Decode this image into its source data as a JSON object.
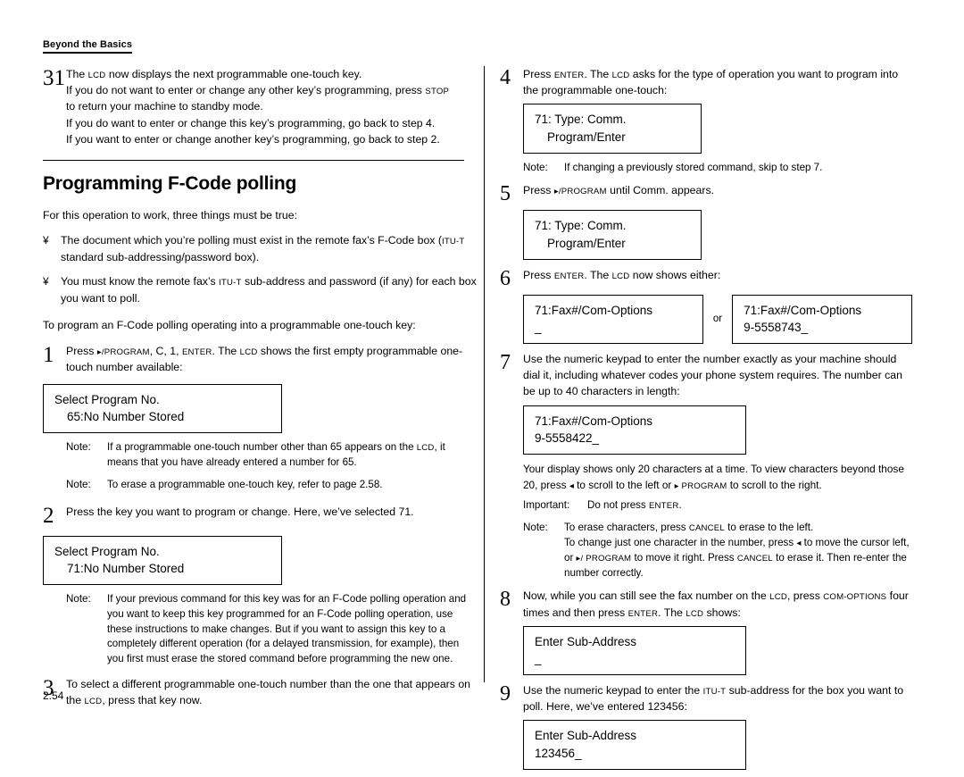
{
  "page": {
    "header_tab": "Beyond the Basics",
    "footer_page": "2.54",
    "section_title": "Programming F-Code polling"
  },
  "left_column": {
    "step31": {
      "number": "31",
      "line1_pre": "The ",
      "line1_lcd": "LCD",
      "line1_post": " now displays the next programmable one-touch key.",
      "line2_a": "If you do not want to enter or change any other key’s programming, press ",
      "line2_sc": "STOP",
      "line3": "to return your machine to standby mode.",
      "line4": "If you do want to enter or change this key’s programming, go back to step 4.",
      "line5": "If you want to enter or change another key’s programming, go back to step 2."
    },
    "intro": "For this operation to work, three things must be true:",
    "bullets": [
      {
        "mark": "¥",
        "text_a": "The document which you’re polling must exist in the remote fax’s F-Code box (",
        "text_sc": "ITU-T",
        "text_b": " standard sub-addressing/password box)."
      },
      {
        "mark": "¥",
        "text_a": "You must know the remote fax’s ",
        "text_sc": "ITU-T",
        "text_b": " sub-address and password (if any) for each box you want to poll."
      }
    ],
    "lead_in": "To program an F-Code polling operating into a programmable one-touch key:",
    "step1": {
      "number": "1",
      "text_a": "Press ",
      "sc1": "▸/PROGRAM",
      "text_b": ", C, 1, ",
      "sc2": "ENTER",
      "text_c": ". The ",
      "sc3": "LCD",
      "text_d": " shows the first empty programmable one-touch number available:",
      "lcd_line1": "Select Program No.",
      "lcd_line2": "65:No Number Stored"
    },
    "note1": {
      "label": "Note:",
      "text_a": "If a programmable one-touch number other than 65 appears on the ",
      "sc": "LCD",
      "text_b": ", it means that you have already entered a number for 65."
    },
    "note2": {
      "label": "Note:",
      "text": "To erase a programmable one-touch key, refer to page 2.58."
    },
    "step2": {
      "number": "2",
      "text": "Press the key you want to program or change. Here, we’ve selected 71.",
      "lcd_line1": "Select Program No.",
      "lcd_line2": "71:No Number Stored"
    },
    "note3": {
      "label": "Note:",
      "text": "If your previous command for this key was for an F-Code polling operation and you want to keep this key programmed for an F-Code polling operation, use these instructions to make changes. But if you want to assign this key to a completely different operation (for a delayed transmission, for example), then you first must erase the stored command before programming the new one."
    },
    "step3": {
      "number": "3",
      "text_a": "To select a different programmable one-touch number than the one that appears on the ",
      "sc": "LCD",
      "text_b": ", press that key now."
    }
  },
  "right_column": {
    "step4": {
      "number": "4",
      "text_a": "Press ",
      "sc1": "ENTER",
      "text_b": ". The ",
      "sc2": "LCD",
      "text_c": " asks for the type of operation you want to program into the programmable one-touch:",
      "lcd_line1": "71:  Type: Comm.",
      "lcd_line2": "Program/Enter"
    },
    "note4": {
      "label": "Note:",
      "text": "If changing a previously stored command, skip to step 7."
    },
    "step5": {
      "number": "5",
      "text_a": "Press ",
      "sc": "▸/PROGRAM",
      "text_b": " until Comm. appears.",
      "lcd_line1": "71:  Type: Comm.",
      "lcd_line2": "Program/Enter"
    },
    "step6": {
      "number": "6",
      "text_a": "Press ",
      "sc1": "ENTER",
      "text_b": ". The ",
      "sc2": "LCD",
      "text_c": " now shows either:",
      "lcd_a_line1": "71:Fax#/Com-Options",
      "lcd_a_line2": "_",
      "or": "or",
      "lcd_b_line1": "71:Fax#/Com-Options",
      "lcd_b_line2": "9-5558743_"
    },
    "step7": {
      "number": "7",
      "text": "Use the numeric keypad to enter the number exactly as your machine should dial it, including whatever codes your phone system requires. The number can be up to 40 characters in length:",
      "lcd_line1": "71:Fax#/Com-Options",
      "lcd_line2": "9-5558422_",
      "after_a": "Your display shows only 20 characters at a time. To view characters beyond those 20, press ",
      "after_arrow1": "◂",
      "after_b": " to scroll to the left or ",
      "after_sc": "▸ PROGRAM",
      "after_c": " to scroll to the right."
    },
    "important": {
      "label": "Important:",
      "text_a": "Do not press ",
      "sc": "ENTER",
      "text_b": "."
    },
    "note5": {
      "label": "Note:",
      "line1_a": "To erase characters, press ",
      "line1_sc": "CANCEL",
      "line1_b": " to erase to the left.",
      "line2_a": "To change just one character in the number, press ",
      "line2_arrow": "◂",
      "line2_b": " to move the cursor left, or ",
      "line2_sc": "▸/ PROGRAM",
      "line2_c": " to move it right. Press ",
      "line2_sc2": "CANCEL",
      "line2_d": " to erase it. Then re-enter the number correctly."
    },
    "step8": {
      "number": "8",
      "text_a": "Now, while you can still see the fax number on the ",
      "sc1": "LCD",
      "text_b": ", press ",
      "sc2": "COM-OPTIONS",
      "text_c": " four times and then press ",
      "sc3": "ENTER",
      "text_d": ". The ",
      "sc4": "LCD",
      "text_e": " shows:",
      "lcd_line1": "Enter Sub-Address",
      "lcd_line2": "_"
    },
    "step9": {
      "number": "9",
      "text_a": "Use the numeric keypad to enter the ",
      "sc": "ITU-T",
      "text_b": " sub-address for the box you want to poll. Here, we’ve entered 123456:",
      "lcd_line1": "Enter Sub-Address",
      "lcd_line2": "123456_"
    }
  }
}
